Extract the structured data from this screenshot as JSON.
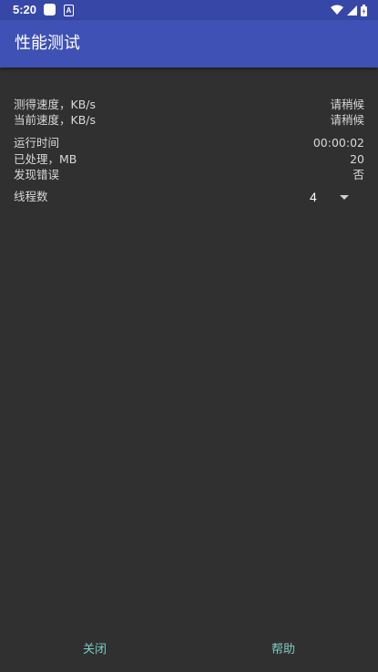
{
  "status_bar": {
    "time": "5:20",
    "notif_a": "A"
  },
  "app_bar": {
    "title": "性能测试"
  },
  "stats": {
    "measured_speed_label": "测得速度，KB/s",
    "measured_speed_value": "请稍候",
    "current_speed_label": "当前速度，KB/s",
    "current_speed_value": "请稍候",
    "run_time_label": "运行时间",
    "run_time_value": "00:00:02",
    "processed_label": "已处理，MB",
    "processed_value": "20",
    "error_label": "发现错误",
    "error_value": "否"
  },
  "threads": {
    "label": "线程数",
    "value": "4"
  },
  "buttons": {
    "close": "关闭",
    "help": "帮助"
  },
  "colors": {
    "status_bar": "#3647a8",
    "app_bar": "#3f51b5",
    "background": "#303030",
    "accent": "#80cbc4"
  }
}
